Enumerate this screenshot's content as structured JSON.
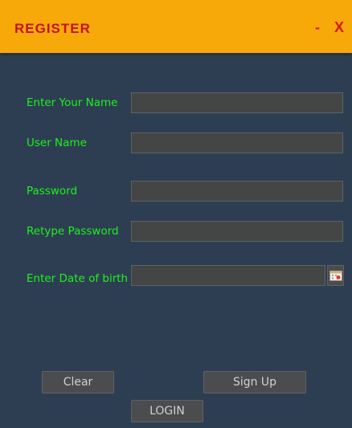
{
  "window": {
    "title": "REGISTER",
    "minimize_label": "-",
    "close_label": "X"
  },
  "form": {
    "name_label": "Enter Your Name",
    "name_value": "",
    "username_label": "User Name",
    "username_value": "",
    "password_label": "Password",
    "password_value": "",
    "retype_label": "Retype Password",
    "retype_value": "",
    "dob_label": "Enter Date of birth",
    "dob_value": "",
    "calendar_icon": "calendar-icon"
  },
  "buttons": {
    "clear_label": "Clear",
    "signup_label": "Sign Up",
    "login_label": "LOGIN"
  },
  "colors": {
    "titlebar": "#f7a90a",
    "title_text": "#c81212",
    "background": "#2e3e52",
    "label_text": "#1cf21c",
    "field_bg": "#444646"
  }
}
